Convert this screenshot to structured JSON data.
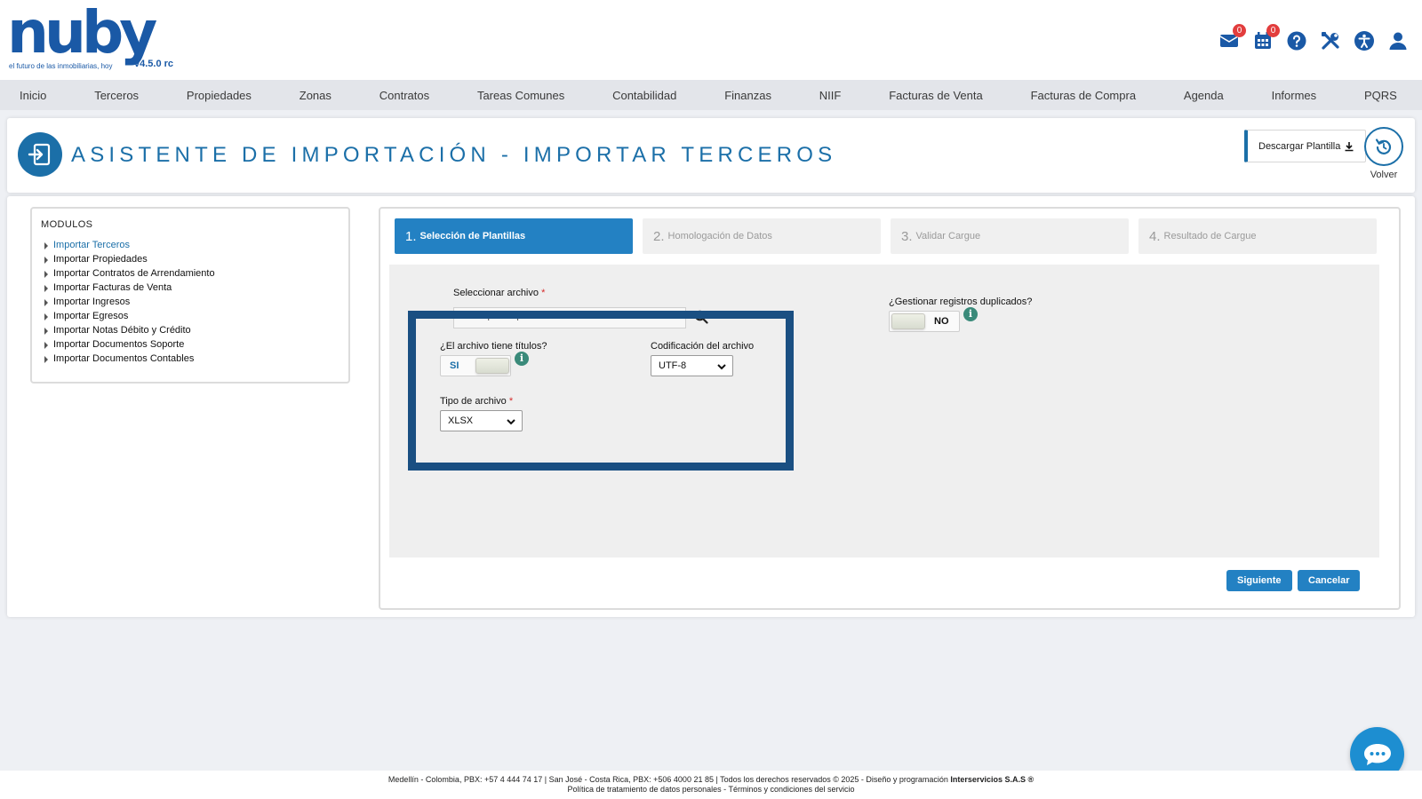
{
  "brand": {
    "logo_text": "nuby",
    "tagline": "el futuro de las inmobiliarias, hoy",
    "version": "v4.5.0 rc",
    "primary_color": "#1b6fa8",
    "accent_color": "#2381c3"
  },
  "header": {
    "mail_badge": "0",
    "calendar_badge": "0",
    "icons": [
      "envelope-icon",
      "calendar-icon",
      "help-icon",
      "tools-icon",
      "accessibility-icon",
      "user-icon"
    ]
  },
  "nav": {
    "items": [
      "Inicio",
      "Terceros",
      "Propiedades",
      "Zonas",
      "Contratos",
      "Tareas Comunes",
      "Contabilidad",
      "Finanzas",
      "NIIF",
      "Facturas de Venta",
      "Facturas de Compra",
      "Agenda",
      "Informes",
      "PQRS"
    ]
  },
  "title_bar": {
    "title": "ASISTENTE DE IMPORTACIÓN - IMPORTAR TERCEROS",
    "download_label": "Descargar Plantilla",
    "back_label": "Volver"
  },
  "modules": {
    "title": "MODULOS",
    "items": [
      "Importar Terceros",
      "Importar Propiedades",
      "Importar Contratos de Arrendamiento",
      "Importar Facturas de Venta",
      "Importar Ingresos",
      "Importar Egresos",
      "Importar Notas Débito y Crédito",
      "Importar Documentos Soporte",
      "Importar Documentos Contables"
    ],
    "active_index": 0
  },
  "steps": [
    {
      "num": "1.",
      "label": "Selección de Plantillas"
    },
    {
      "num": "2.",
      "label": "Homologación de Datos"
    },
    {
      "num": "3.",
      "label": "Validar Cargue"
    },
    {
      "num": "4.",
      "label": "Resultado de Cargue"
    }
  ],
  "form": {
    "file_label": "Seleccionar archivo",
    "required_mark": "*",
    "file_value": "C:\\fakepath\\importar-terceros.xlsx",
    "has_titles_label": "¿El archivo tiene títulos?",
    "has_titles_value": "SI",
    "encoding_label": "Codificación del archivo",
    "encoding_value": "UTF-8",
    "file_type_label": "Tipo de archivo",
    "file_type_value": "XLSX",
    "duplicates_label": "¿Gestionar registros duplicados?",
    "duplicates_value": "NO",
    "info_glyph": "i"
  },
  "actions": {
    "next_label": "Siguiente",
    "cancel_label": "Cancelar"
  },
  "footer": {
    "line1": "Medellín - Colombia, PBX: +57 4 444 74 17 | San José - Costa Rica, PBX: +506 4000 21 85 | Todos los derechos reservados © 2025 - Diseño y programación",
    "company": "Interservicios S.A.S ®",
    "line2": "Política de tratamiento de datos personales - Términos y condiciones del servicio"
  }
}
